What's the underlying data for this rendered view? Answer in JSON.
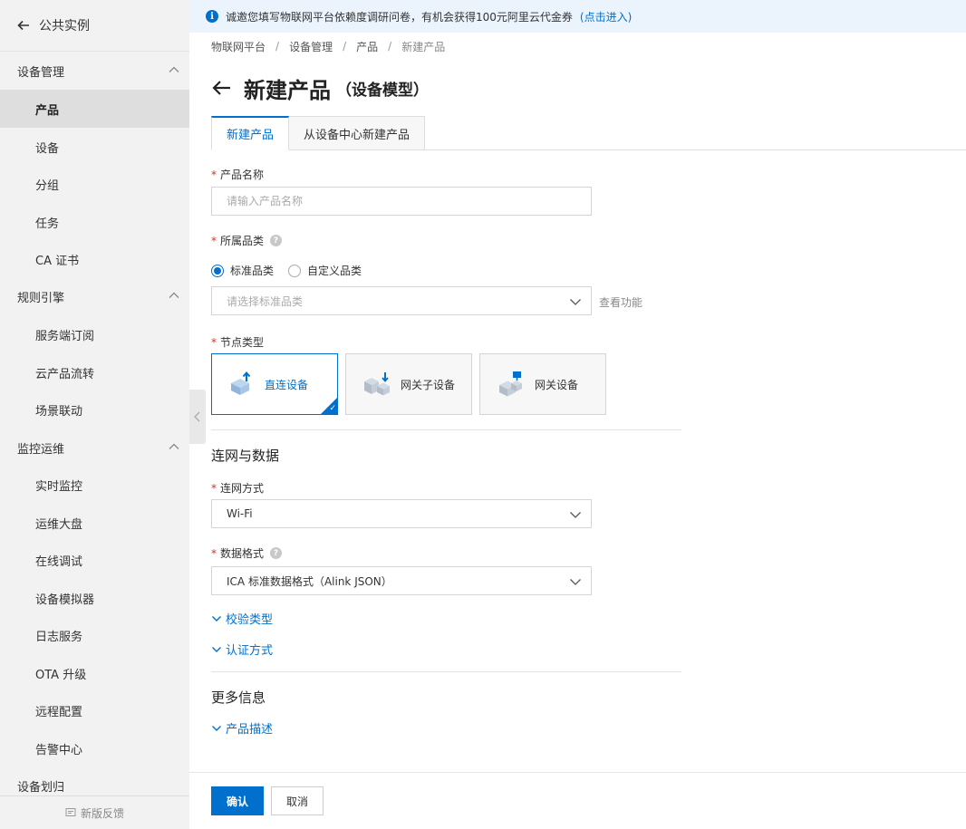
{
  "sidebar": {
    "back_label": "公共实例",
    "groups": [
      {
        "label": "设备管理",
        "items": [
          "产品",
          "设备",
          "分组",
          "任务",
          "CA 证书"
        ]
      },
      {
        "label": "规则引擎",
        "items": [
          "服务端订阅",
          "云产品流转",
          "场景联动"
        ]
      },
      {
        "label": "监控运维",
        "items": [
          "实时监控",
          "运维大盘",
          "在线调试",
          "设备模拟器",
          "日志服务",
          "OTA 升级",
          "远程配置",
          "告警中心"
        ]
      },
      {
        "label": "设备划归"
      }
    ],
    "active_item": "产品",
    "feedback_label": "新版反馈"
  },
  "notice": {
    "text": "诚邀您填写物联网平台依赖度调研问卷，有机会获得100元阿里云代金券",
    "link": "(点击进入)"
  },
  "breadcrumb": [
    "物联网平台",
    "设备管理",
    "产品",
    "新建产品"
  ],
  "title": {
    "main": "新建产品",
    "sub": "（设备模型）"
  },
  "tabs": [
    "新建产品",
    "从设备中心新建产品"
  ],
  "form": {
    "product_name": {
      "label": "产品名称",
      "placeholder": "请输入产品名称"
    },
    "category": {
      "label": "所属品类",
      "options": [
        "标准品类",
        "自定义品类"
      ],
      "selected": "标准品类",
      "select_placeholder": "请选择标准品类",
      "view_features": "查看功能"
    },
    "node_type": {
      "label": "节点类型",
      "options": [
        "直连设备",
        "网关子设备",
        "网关设备"
      ],
      "selected": "直连设备"
    },
    "network_section_title": "连网与数据",
    "connect_method": {
      "label": "连网方式",
      "value": "Wi-Fi"
    },
    "data_format": {
      "label": "数据格式",
      "value": "ICA 标准数据格式（Alink JSON）"
    },
    "verify_type": "校验类型",
    "auth_method": "认证方式",
    "more_section_title": "更多信息",
    "product_desc": "产品描述"
  },
  "buttons": {
    "confirm": "确认",
    "cancel": "取消"
  },
  "colors": {
    "primary": "#0070cc",
    "required": "#d93026",
    "sidebar_bg": "#f2f2f2",
    "notice_bg": "#ebf4fd"
  }
}
